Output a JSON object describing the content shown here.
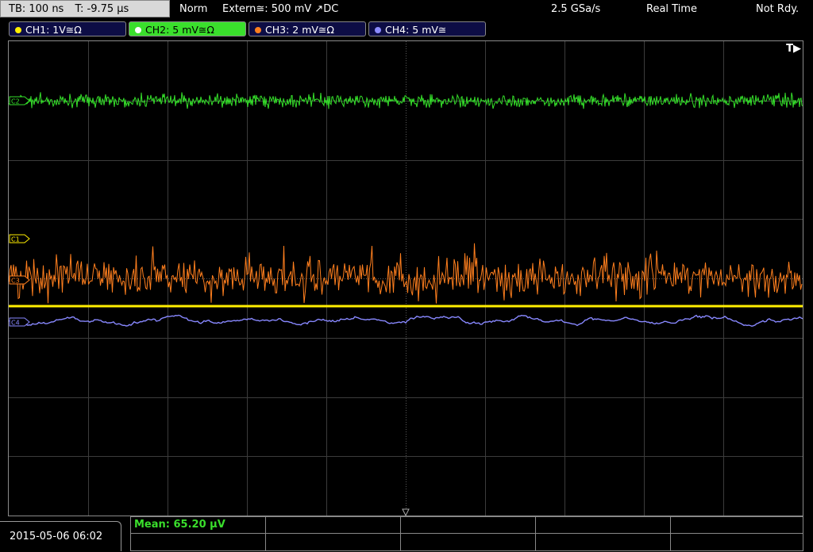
{
  "topbar": {
    "timebase": "TB: 100 ns",
    "trigger_time": "T: -9.75 µs",
    "mode": "Norm",
    "trigger_source": "Extern≅: 500 mV ↗DC",
    "sample_rate": "2.5 GSa/s",
    "acq_mode": "Real Time",
    "status": "Not Rdy."
  },
  "channels": [
    {
      "label": "CH1: 1V≅Ω",
      "color": "#ffee00",
      "active": false
    },
    {
      "label": "CH2: 5 mV≅Ω",
      "color": "#3adf2c",
      "active": true
    },
    {
      "label": "CH3: 2 mV≅Ω",
      "color": "#ff7f1e",
      "active": false
    },
    {
      "label": "CH4: 5 mV≅",
      "color": "#8c8cff",
      "active": false
    }
  ],
  "screen": {
    "trigger_marker": "T▶",
    "markers": {
      "ch1": "C1",
      "ch2": "C2",
      "ch3": "C3",
      "ch4": "C4"
    }
  },
  "bottom": {
    "datetime": "2015-05-06 06:02",
    "measurement": "Mean: 65.20 µV"
  }
}
